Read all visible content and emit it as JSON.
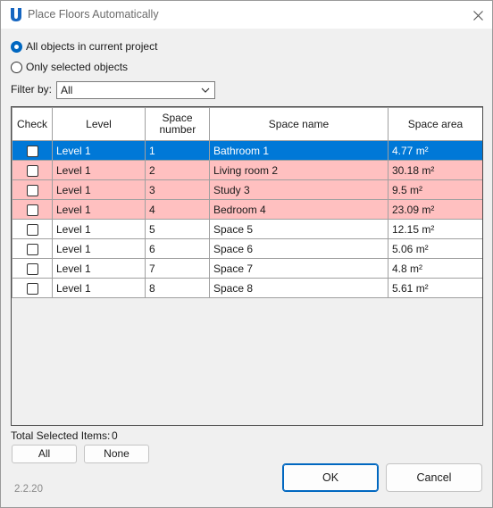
{
  "window": {
    "title": "Place Floors Automatically"
  },
  "scope": {
    "option_all": "All objects in current project",
    "option_selected": "Only selected objects",
    "selected": "all"
  },
  "filter": {
    "label": "Filter by:",
    "value": "All"
  },
  "table": {
    "headers": {
      "check": "Check",
      "level": "Level",
      "space_number": "Space number",
      "space_name": "Space name",
      "space_area": "Space area"
    },
    "rows": [
      {
        "checked": false,
        "level": "Level 1",
        "number": "1",
        "name": "Bathroom 1",
        "area": "4.77 m²",
        "state": "selected"
      },
      {
        "checked": false,
        "level": "Level 1",
        "number": "2",
        "name": "Living room 2",
        "area": "30.18 m²",
        "state": "highlight"
      },
      {
        "checked": false,
        "level": "Level 1",
        "number": "3",
        "name": "Study 3",
        "area": "9.5 m²",
        "state": "highlight"
      },
      {
        "checked": false,
        "level": "Level 1",
        "number": "4",
        "name": "Bedroom 4",
        "area": "23.09 m²",
        "state": "highlight"
      },
      {
        "checked": false,
        "level": "Level 1",
        "number": "5",
        "name": "Space 5",
        "area": "12.15 m²",
        "state": "normal"
      },
      {
        "checked": false,
        "level": "Level 1",
        "number": "6",
        "name": "Space 6",
        "area": "5.06 m²",
        "state": "normal"
      },
      {
        "checked": false,
        "level": "Level 1",
        "number": "7",
        "name": "Space 7",
        "area": "4.8 m²",
        "state": "normal"
      },
      {
        "checked": false,
        "level": "Level 1",
        "number": "8",
        "name": "Space 8",
        "area": "5.61 m²",
        "state": "normal"
      }
    ]
  },
  "footer": {
    "total_label": "Total Selected Items:",
    "total_value": "0",
    "all_button": "All",
    "none_button": "None",
    "ok_button": "OK",
    "cancel_button": "Cancel",
    "version": "2.2.20"
  },
  "colors": {
    "accent": "#0067c0",
    "selected_row": "#0078d7",
    "highlight_row": "#ffc0c0",
    "app_icon": "#1565c0"
  },
  "icons": {
    "app": "app-u-logo-icon",
    "close": "close-icon",
    "dropdown": "chevron-down-icon"
  }
}
